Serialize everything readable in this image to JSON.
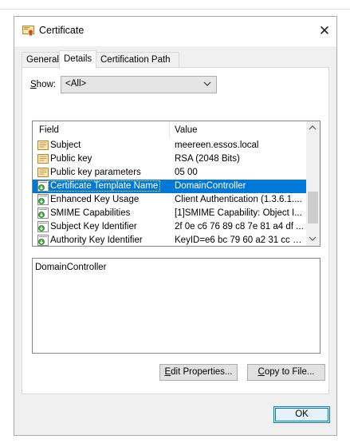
{
  "window": {
    "title": "Certificate",
    "close_glyph": "✕"
  },
  "tabs": [
    {
      "label": "General"
    },
    {
      "label": "Details"
    },
    {
      "label": "Certification Path"
    }
  ],
  "show": {
    "label_prefix": "S",
    "label_rest": "how:",
    "selected": "<All>"
  },
  "list": {
    "headers": {
      "field": "Field",
      "value": "Value"
    },
    "rows": [
      {
        "field": "Subject",
        "value": "meereen.essos.local",
        "icon": "certificate-field-icon"
      },
      {
        "field": "Public key",
        "value": "RSA (2048 Bits)",
        "icon": "certificate-field-icon"
      },
      {
        "field": "Public key parameters",
        "value": "05 00",
        "icon": "certificate-field-icon"
      },
      {
        "field": "Certificate Template Name",
        "value": "DomainController",
        "icon": "extension-icon",
        "selected": true
      },
      {
        "field": "Enhanced Key Usage",
        "value": "Client Authentication (1.3.6.1....",
        "icon": "extension-icon"
      },
      {
        "field": "SMIME Capabilities",
        "value": "[1]SMIME Capability: Object I...",
        "icon": "extension-icon"
      },
      {
        "field": "Subject Key Identifier",
        "value": "2f 0e c6 76 89 c8 7e 81 a4 df ...",
        "icon": "extension-icon"
      },
      {
        "field": "Authority Key Identifier",
        "value": "KeyID=e6 bc 79 60 a2 31 cc c...",
        "icon": "extension-icon"
      }
    ]
  },
  "detail": {
    "text": "DomainController"
  },
  "buttons": {
    "edit_mnemonic": "E",
    "edit_rest": "dit Properties...",
    "copy_mnemonic": "C",
    "copy_rest": "opy to File...",
    "ok": "OK"
  }
}
